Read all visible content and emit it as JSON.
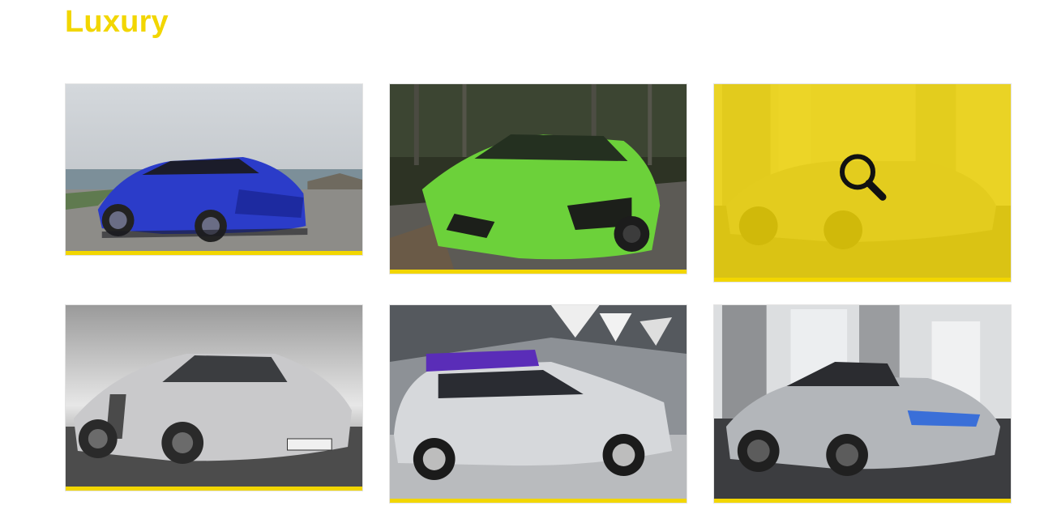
{
  "section": {
    "title": "Luxury"
  },
  "colors": {
    "accent": "#f2d600",
    "card_border": "#e3e3e3"
  },
  "gallery": {
    "items": [
      {
        "subject": "blue-sports-car",
        "hovered": false
      },
      {
        "subject": "green-sports-car",
        "hovered": false
      },
      {
        "subject": "silver-roadster",
        "hovered": true,
        "overlay_icon": "magnifier-icon"
      },
      {
        "subject": "silver-coupe",
        "hovered": false
      },
      {
        "subject": "silver-hatchback-purple-roof",
        "hovered": false
      },
      {
        "subject": "silver-roadster",
        "hovered": false
      }
    ]
  }
}
